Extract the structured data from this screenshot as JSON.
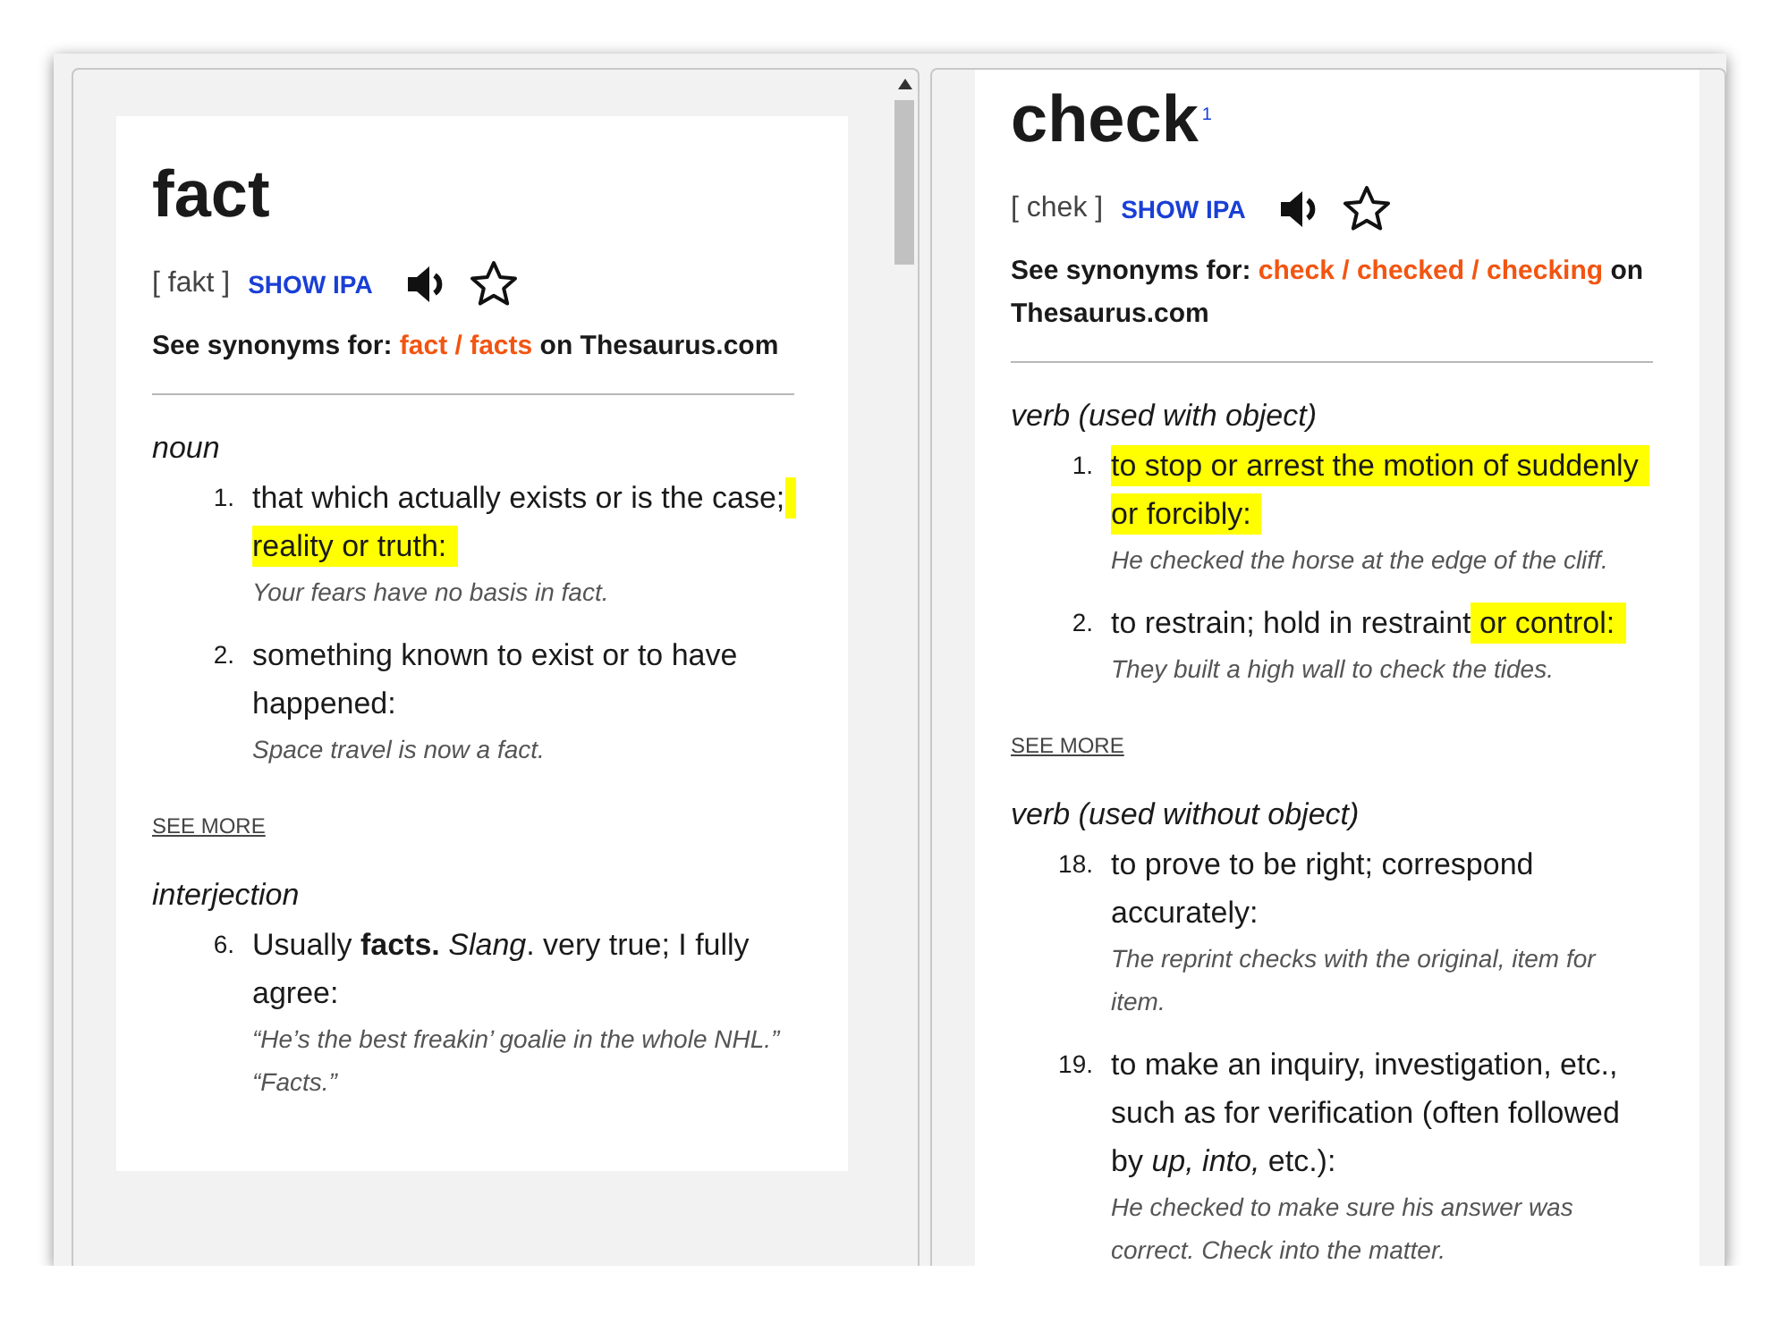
{
  "panes": [
    {
      "headword": "fact",
      "pronunciation": "[ fakt ]",
      "show_ipa": "SHOW IPA",
      "synonyms": {
        "label": "See synonyms for:",
        "words": [
          "fact",
          "facts"
        ],
        "separator": "/",
        "suffix": "on Thesaurus.com"
      },
      "scrollbar": true,
      "card": true,
      "sections": [
        {
          "pos": "noun",
          "senses": [
            {
              "number": "1.",
              "definition": [
                {
                  "text": "that which actually exists or is the case;",
                  "highlighted": false
                },
                {
                  "text": "reality or truth:",
                  "highlighted": true
                }
              ],
              "example": "Your fears have no basis in fact."
            },
            {
              "number": "2.",
              "definition": [
                {
                  "text": "something known to exist or to have happened:",
                  "highlighted": false
                }
              ],
              "example": "Space travel is now a fact."
            }
          ],
          "see_more": "SEE MORE"
        },
        {
          "pos": "interjection",
          "senses": [
            {
              "number": "6.",
              "definition": [
                {
                  "text": "Usually **facts.** *Slang*. very true; I fully agree:",
                  "highlighted": false
                }
              ],
              "example": "“He’s the best freakin’ goalie in the whole NHL.” “Facts.”"
            }
          ]
        }
      ]
    },
    {
      "headword": "check",
      "superscript": "1",
      "pronunciation": "[ chek ]",
      "show_ipa": "SHOW IPA",
      "synonyms": {
        "label": "See synonyms for:",
        "words": [
          "check",
          "checked",
          "checking"
        ],
        "separator": "/",
        "suffix": "on Thesaurus.com"
      },
      "scrollbar": false,
      "card": false,
      "sections": [
        {
          "pos": "verb (used with object)",
          "senses": [
            {
              "number": "1.",
              "definition": [
                {
                  "text": "to stop or arrest the motion of suddenly or forcibly:",
                  "highlighted": true
                }
              ],
              "example": "He checked the horse at the edge of the cliff."
            },
            {
              "number": "2.",
              "definition": [
                {
                  "text": "to restrain; hold in restraint",
                  "highlighted": false
                },
                {
                  "text": "or control:",
                  "highlighted": true
                }
              ],
              "example": "They built a high wall to check the tides."
            }
          ],
          "see_more": "SEE MORE"
        },
        {
          "pos": "verb (used without object)",
          "senses": [
            {
              "number": "18.",
              "definition": [
                {
                  "text": "to prove to be right; correspond accurately:",
                  "highlighted": false
                }
              ],
              "example": "The reprint checks with the original, item for item."
            },
            {
              "number": "19.",
              "definition": [
                {
                  "text": "to make an inquiry, investigation, etc., such as for verification (often followed by *up, into,* etc.):",
                  "highlighted": false
                }
              ],
              "example": "He checked to make sure his answer was correct. Check into the matter."
            }
          ]
        }
      ]
    }
  ]
}
